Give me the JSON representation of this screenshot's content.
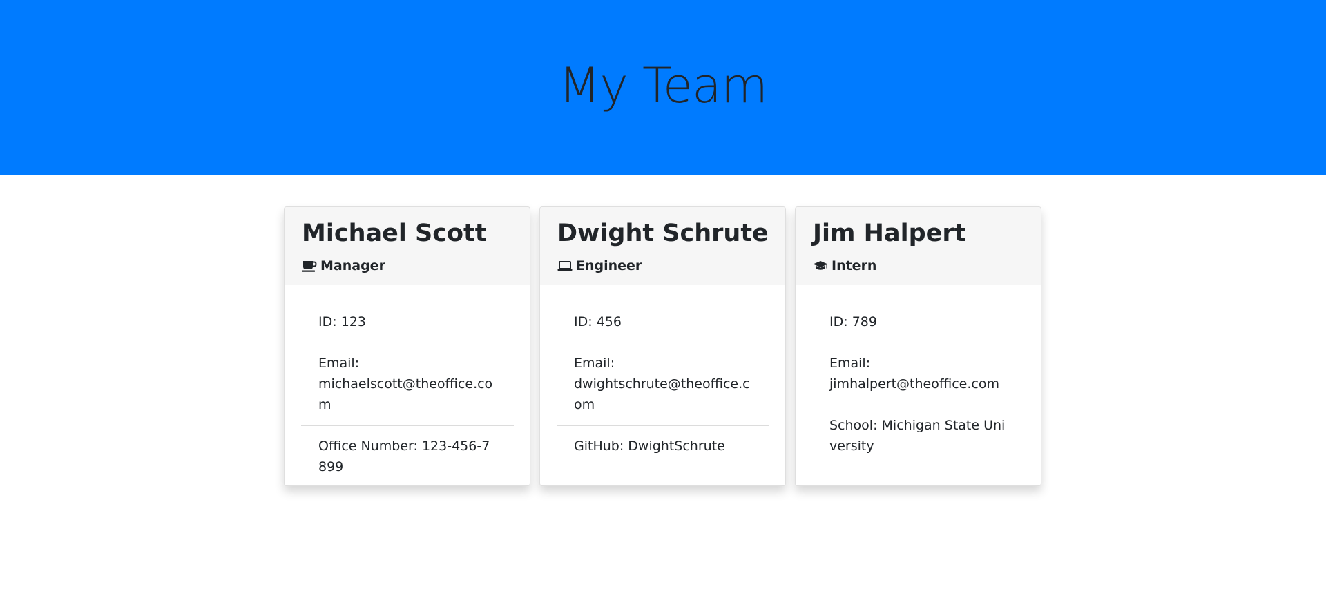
{
  "hero": {
    "title": "My Team"
  },
  "colors": {
    "hero_background": "#007bff",
    "card_header_background": "#f6f6f6"
  },
  "team": [
    {
      "name": "Michael Scott",
      "role": "Manager",
      "role_icon": "coffee-mug-icon",
      "details": [
        {
          "label": "ID:",
          "value": "123"
        },
        {
          "label": "Email:",
          "value": "michaelscott@theoffice.com"
        },
        {
          "label": "Office Number:",
          "value": "123-456-7899"
        }
      ]
    },
    {
      "name": "Dwight Schrute",
      "role": "Engineer",
      "role_icon": "laptop-icon",
      "details": [
        {
          "label": "ID:",
          "value": "456"
        },
        {
          "label": "Email:",
          "value": "dwightschrute@theoffice.com"
        },
        {
          "label": "GitHub:",
          "value": "DwightSchrute"
        }
      ]
    },
    {
      "name": "Jim Halpert",
      "role": "Intern",
      "role_icon": "graduation-cap-icon",
      "details": [
        {
          "label": "ID:",
          "value": "789"
        },
        {
          "label": "Email:",
          "value": "jimhalpert@theoffice.com"
        },
        {
          "label": "School:",
          "value": "Michigan State University"
        }
      ]
    }
  ]
}
